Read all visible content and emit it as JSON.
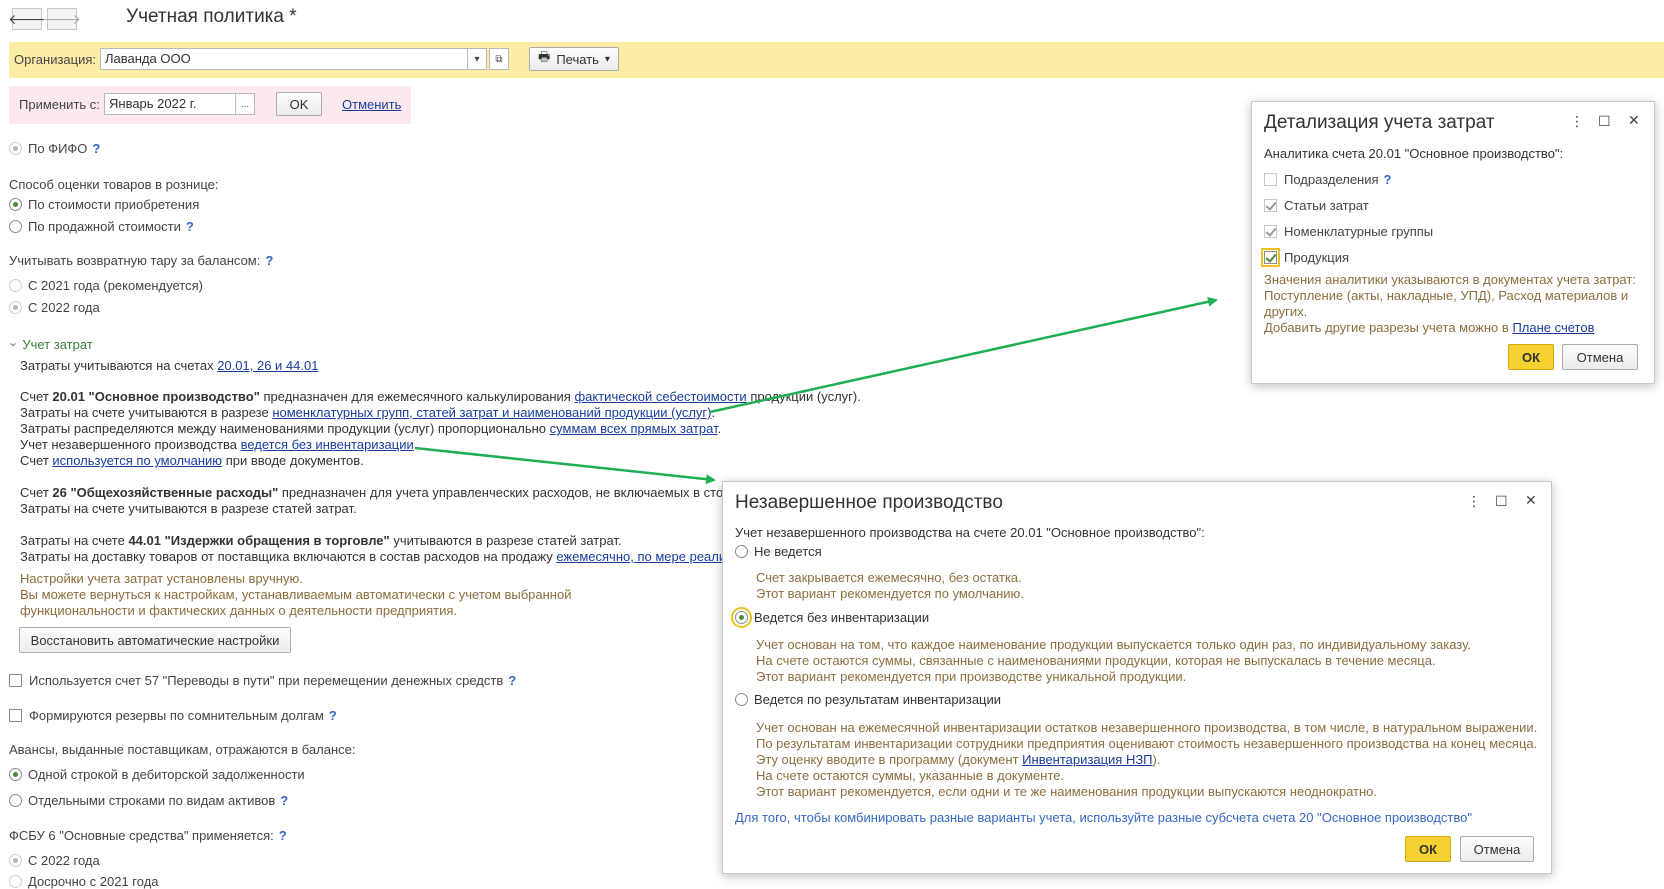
{
  "window": {
    "title": "Учетная политика *"
  },
  "header": {
    "org_label": "Организация:",
    "org_value": "Лаванда ООО",
    "print_label": "Печать"
  },
  "apply": {
    "label": "Применить с:",
    "value": "Январь 2022 г.",
    "dots": "...",
    "ok_label": "OK",
    "cancel_label": "Отменить"
  },
  "main": {
    "fifo_label": "По ФИФО",
    "retail_heading": "Способ оценки товаров в рознице:",
    "retail_options": [
      "По стоимости приобретения",
      "По продажной стоимости"
    ],
    "tare_heading": "Учитывать возвратную тару за балансом:",
    "tare_options": [
      "С 2021 года (рекомендуется)",
      "С 2022 года"
    ],
    "costs_section": "Учет затрат",
    "costs_accounts_prefix": "Затраты учитываются на счетах",
    "costs_accounts_link": "20.01, 26 и 44.01",
    "acc2001": {
      "l1_prefix": "Счет",
      "l1_bold": "20.01 \"Основное производство\"",
      "l1_mid": "предназначен для ежемесячного калькулирования",
      "l1_link": "фактической себестоимости",
      "l1_suffix": "продукции (услуг).",
      "l2_prefix": "Затраты на счете учитываются в разрезе",
      "l2_link": "номенклатурных групп, статей затрат и наименований продукции (услуг)",
      "l2_suffix": ".",
      "l3_prefix": "Затраты распределяются между наименованиями продукции (услуг) пропорционально",
      "l3_link": "суммам всех прямых затрат",
      "l3_suffix": ".",
      "l4_prefix": "Учет незавершенного производства",
      "l4_link": "ведется без инвентаризации",
      "l4_suffix": ".",
      "l5_prefix": "Счет",
      "l5_link": "используется по умолчанию",
      "l5_suffix": "при вводе документов."
    },
    "acc26": {
      "l1_prefix": "Счет",
      "l1_bold": "26 \"Общехозяйственные расходы\"",
      "l1_suffix": "предназначен для учета управленческих расходов, не включаемых в сто",
      "l2": "Затраты на счете учитываются в разрезе статей затрат."
    },
    "acc4401": {
      "l1_prefix": "Затраты на счете",
      "l1_bold": "44.01 \"Издержки обращения в торговле\"",
      "l1_suffix": "учитываются в разрезе статей затрат.",
      "l2_prefix": "Затраты на доставку товаров от поставщика включаются в состав расходов на продажу",
      "l2_link": "ежемесячно, по мере реализ"
    },
    "manual_note": [
      "Настройки учета затрат установлены вручную.",
      "Вы можете вернуться к настройкам, устанавливаемым автоматически с учетом выбранной",
      "функциональности и фактических данных о деятельности предприятия."
    ],
    "restore_button": "Восстановить автоматические настройки",
    "acc57_label": "Используется счет 57 \"Переводы в пути\" при перемещении денежных средств",
    "reserves_label": "Формируются резервы по сомнительным долгам",
    "advances_heading": "Авансы, выданные поставщикам, отражаются в балансе:",
    "advances_options": [
      "Одной строкой в дебиторской задолженности",
      "Отдельными строками по видам активов"
    ],
    "fsbu_heading": "ФСБУ 6 \"Основные средства\" применяется:",
    "fsbu_options": [
      "С 2022 года",
      "Досрочно с 2021 года"
    ],
    "help_mark": "?"
  },
  "dialog_costs": {
    "title": "Детализация учета затрат",
    "subtitle": "Аналитика счета 20.01 \"Основное производство\":",
    "items": [
      "Подразделения",
      "Статьи затрат",
      "Номенклатурные группы",
      "Продукция"
    ],
    "note": [
      "Значения аналитики указываются в документах учета затрат:",
      "Поступление (акты, накладные, УПД), Расход материалов и",
      "других."
    ],
    "plan_prefix": "Добавить другие разрезы учета можно в",
    "plan_link": "Плане счетов",
    "ok_label": "ОК",
    "cancel_label": "Отмена"
  },
  "dialog_wip": {
    "title": "Незавершенное производство",
    "subtitle": "Учет незавершенного производства на счете 20.01 \"Основное производство\":",
    "opt1": "Не ведется",
    "opt1_note": [
      "Счет закрывается ежемесячно, без остатка.",
      "Этот вариант рекомендуется по умолчанию."
    ],
    "opt2": "Ведется без инвентаризации",
    "opt2_note": [
      "Учет основан на том, что каждое наименование продукции выпускается только один раз, по индивидуальному заказу.",
      "На счете остаются суммы, связанные с наименованиями продукции, которая не выпускалась в течение месяца.",
      "Этот вариант рекомендуется при производстве уникальной продукции."
    ],
    "opt3": "Ведется по результатам инвентаризации",
    "opt3_note_a": [
      "Учет основан на ежемесячной инвентаризации остатков незавершенного производства, в том числе, в натуральном выражении.",
      "По результатам инвентаризации сотрудники предприятия оценивают стоимость незавершенного производства на конец месяца."
    ],
    "opt3_doc_prefix": "Эту оценку вводите в программу (документ",
    "opt3_doc_link": "Инвентаризация НЗП",
    "opt3_doc_suffix": ").",
    "opt3_note_b": [
      "На счете остаются суммы, указанные в документе.",
      "Этот вариант рекомендуется, если одни и те же наименования продукции выпускаются неоднократно."
    ],
    "footer_hint": "Для того, чтобы комбинировать разные варианты учета, используйте разные субсчета счета 20 \"Основное производство\"",
    "ok_label": "ОК",
    "cancel_label": "Отмена"
  },
  "colors": {
    "accent_yellow": "#f5d131",
    "arrow_green": "#1fae52",
    "link_blue": "#1a3c9c",
    "note_brown": "#8c6e3e"
  }
}
